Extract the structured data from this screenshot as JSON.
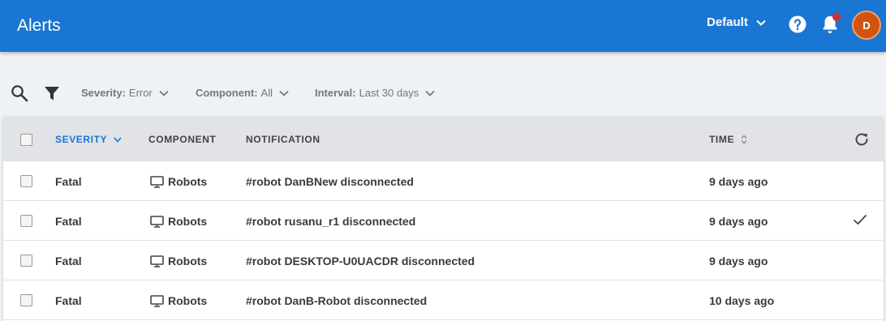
{
  "header": {
    "title": "Alerts",
    "tenant": "Default",
    "avatar_initial": "D",
    "brand_color": "#1976d2",
    "notification_dot_color": "#d32f2f",
    "avatar_color": "#d2530f"
  },
  "filters": {
    "search_icon": "search-icon",
    "filter_icon": "filter-icon",
    "severity": {
      "label": "Severity:",
      "value": "Error"
    },
    "component": {
      "label": "Component:",
      "value": "All"
    },
    "interval": {
      "label": "Interval:",
      "value": "Last 30 days"
    }
  },
  "table": {
    "columns": {
      "severity": "SEVERITY",
      "component": "COMPONENT",
      "notification": "NOTIFICATION",
      "time": "TIME"
    },
    "rows": [
      {
        "severity": "Fatal",
        "component": "Robots",
        "notification": "#robot DanBNew disconnected",
        "time": "9 days ago",
        "acknowledged": false
      },
      {
        "severity": "Fatal",
        "component": "Robots",
        "notification": "#robot rusanu_r1 disconnected",
        "time": "9 days ago",
        "acknowledged": true
      },
      {
        "severity": "Fatal",
        "component": "Robots",
        "notification": "#robot DESKTOP-U0UACDR disconnected",
        "time": "9 days ago",
        "acknowledged": false
      },
      {
        "severity": "Fatal",
        "component": "Robots",
        "notification": "#robot DanB-Robot disconnected",
        "time": "10 days ago",
        "acknowledged": false
      }
    ]
  }
}
